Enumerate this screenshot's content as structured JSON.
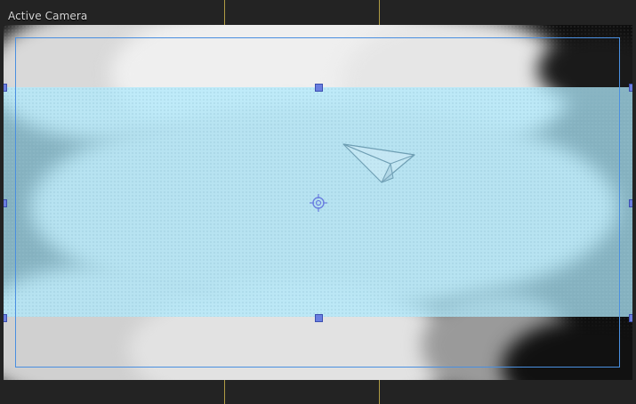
{
  "viewport": {
    "label": "Active Camera"
  },
  "colors": {
    "panel_background": "#232323",
    "frame_border": "#4a8fe0",
    "selection_fill": "#afeafc",
    "handle": "#6a7ee0",
    "guide_line": "#c9b24a"
  },
  "scene": {
    "background": "cloud",
    "icons": [
      "paper-plane-icon",
      "pivot-crosshair-icon"
    ]
  }
}
